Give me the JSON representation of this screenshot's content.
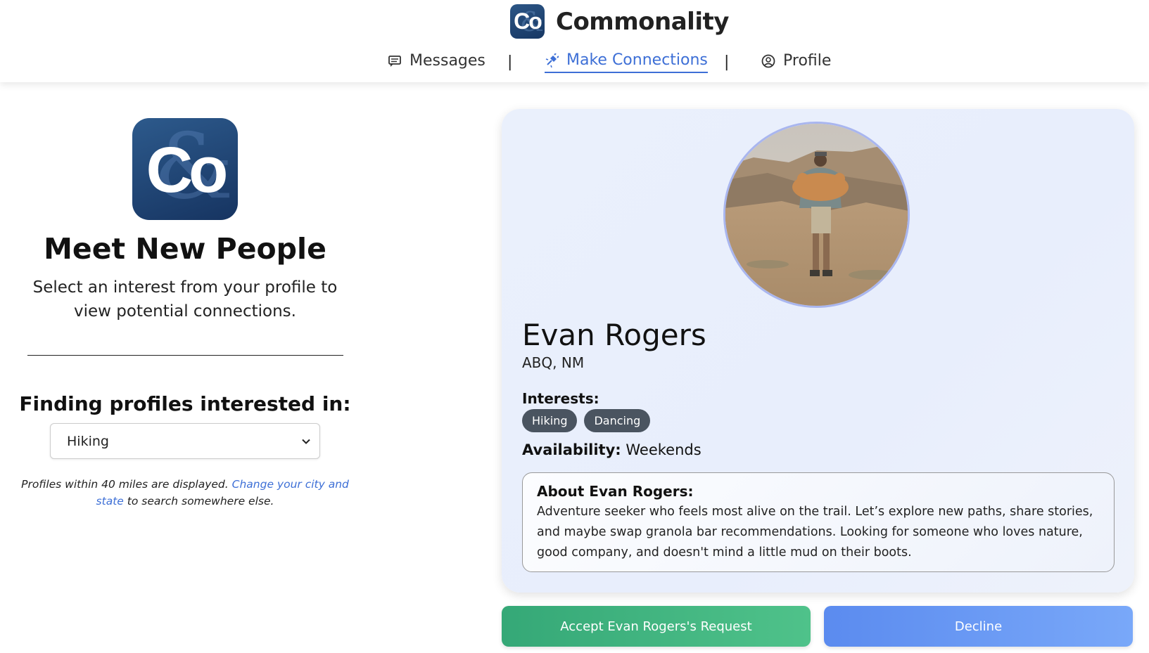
{
  "app": {
    "name": "Commonality",
    "logo_text": "Co"
  },
  "nav": {
    "items": [
      {
        "label": "Messages",
        "icon": "message-icon",
        "active": false
      },
      {
        "label": "Make Connections",
        "icon": "plug-icon",
        "active": true
      },
      {
        "label": "Profile",
        "icon": "user-circle-icon",
        "active": false
      }
    ],
    "separator": "|"
  },
  "left": {
    "logo_text": "Co",
    "title": "Meet New People",
    "subtitle": "Select an interest from your profile to view potential connections.",
    "finding_label": "Finding profiles interested in:",
    "selected_interest": "Hiking",
    "note_prefix": "Profiles within 40 miles are displayed.",
    "note_link": "Change your city and state",
    "note_suffix": "to search somewhere else."
  },
  "profile": {
    "name": "Evan Rogers",
    "location": "ABQ, NM",
    "interests_label": "Interests:",
    "interests": [
      "Hiking",
      "Dancing"
    ],
    "availability_label": "Availability:",
    "availability": "Weekends",
    "about_title": "About Evan Rogers:",
    "about_text": "Adventure seeker who feels most alive on the trail. Let’s explore new paths, share stories, and maybe swap granola bar recommendations. Looking for someone who loves nature, good company, and doesn't mind a little mud on their boots."
  },
  "actions": {
    "accept_label": "Accept Evan Rogers's Request",
    "decline_label": "Decline"
  },
  "colors": {
    "accent": "#3d6fd6",
    "accept": "#3fb47f",
    "decline": "#6597f3",
    "brand": "#1d416f"
  }
}
